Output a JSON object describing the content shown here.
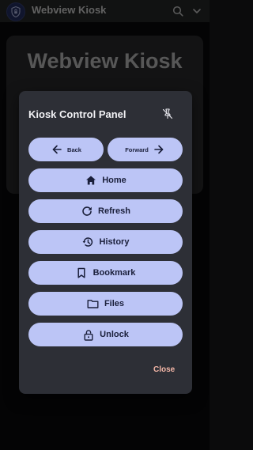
{
  "app": {
    "title": "Webview Kiosk",
    "icons": {
      "app_icon": "shield-lock-icon",
      "search": "search-icon",
      "menu": "chevron-down-icon"
    }
  },
  "page": {
    "heading": "Webview Kiosk"
  },
  "dialog": {
    "title": "Kiosk Control Panel",
    "pin_icon": "pin-off-icon",
    "buttons": {
      "back": "Back",
      "forward": "Forward",
      "home": "Home",
      "refresh": "Refresh",
      "history": "History",
      "bookmark": "Bookmark",
      "files": "Files",
      "unlock": "Unlock"
    },
    "close": "Close"
  },
  "colors": {
    "button_bg": "#bcc5f6",
    "button_text": "#1a1f3a",
    "dialog_bg": "#2d2f36",
    "close_text": "#f3b6a7"
  }
}
